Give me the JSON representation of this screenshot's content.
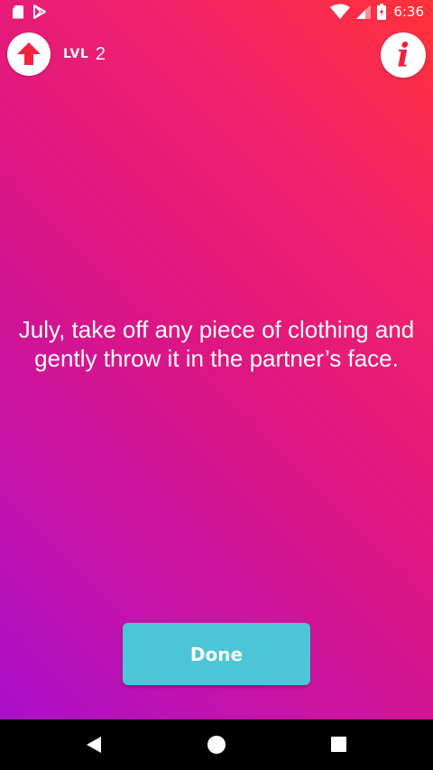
{
  "status_bar": {
    "time": "6:36",
    "icons": [
      "sd-card-icon",
      "play-store-icon",
      "wifi-icon",
      "signal-icon",
      "battery-icon"
    ]
  },
  "header": {
    "up_icon": "arrow-up-icon",
    "level_label": "LVL",
    "level_number": "2",
    "info_icon": "info-icon",
    "info_glyph": "i"
  },
  "card": {
    "message": "July, take off any piece of clothing and gently throw it in the partner’s face."
  },
  "actions": {
    "done_label": "Done"
  },
  "nav_bar": {
    "icons": [
      "back-icon",
      "home-icon",
      "recents-icon"
    ]
  },
  "colors": {
    "gradient_top_right": "#ff3236",
    "gradient_mid": "#dd1682",
    "gradient_bottom_left": "#a40ed0",
    "accent_red": "#f2223f",
    "done_button": "#4cc5d8"
  }
}
